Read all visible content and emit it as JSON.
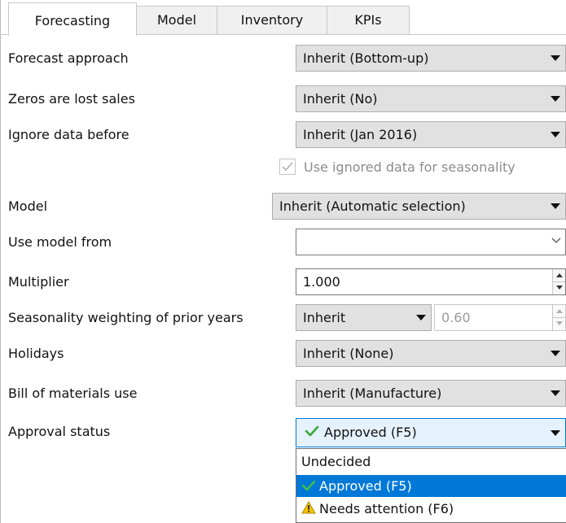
{
  "tabs": [
    {
      "label": "Forecasting",
      "active": true
    },
    {
      "label": "Model",
      "active": false
    },
    {
      "label": "Inventory",
      "active": false
    },
    {
      "label": "KPIs",
      "active": false
    }
  ],
  "fields": {
    "forecast_approach": {
      "label": "Forecast approach",
      "value": "Inherit (Bottom-up)"
    },
    "zeros_lost_sales": {
      "label": "Zeros are lost sales",
      "value": "Inherit (No)"
    },
    "ignore_data_before": {
      "label": "Ignore data before",
      "value": "Inherit (Jan 2016)"
    },
    "use_ignored_seasonality": {
      "label": "Use ignored data for seasonality",
      "checked": true,
      "enabled": false
    },
    "model": {
      "label": "Model",
      "value": "Inherit (Automatic selection)"
    },
    "use_model_from": {
      "label": "Use model from",
      "value": ""
    },
    "multiplier": {
      "label": "Multiplier",
      "value": "1.000"
    },
    "seasonality_weighting": {
      "label": "Seasonality weighting of prior years",
      "value": "Inherit",
      "number": "0.60"
    },
    "holidays": {
      "label": "Holidays",
      "value": "Inherit (None)"
    },
    "bom_use": {
      "label": "Bill of materials use",
      "value": "Inherit (Manufacture)"
    },
    "approval_status": {
      "label": "Approval status",
      "value": "Approved (F5)",
      "icon": "green-check-icon"
    }
  },
  "approval_options": [
    {
      "label": "Undecided",
      "icon": "",
      "selected": false
    },
    {
      "label": "Approved (F5)",
      "icon": "green-check-icon",
      "selected": true
    },
    {
      "label": "Needs attention (F6)",
      "icon": "warning-icon",
      "selected": false
    }
  ],
  "colors": {
    "selection": "#0078d7",
    "check_green": "#3aa83a",
    "warning_yellow": "#f2c200"
  }
}
